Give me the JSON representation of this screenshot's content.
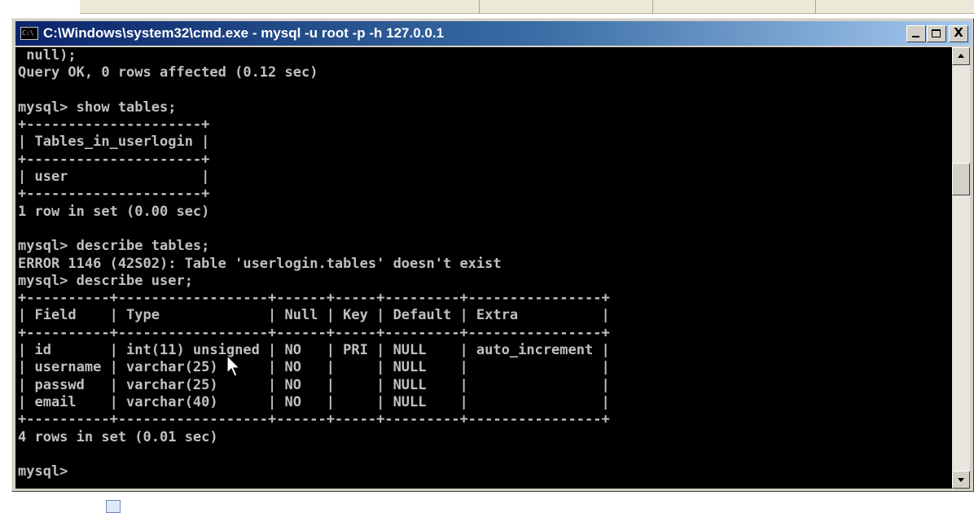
{
  "window": {
    "title": "C:\\Windows\\system32\\cmd.exe - mysql  -u root -p -h 127.0.0.1",
    "icon_name": "console-icon",
    "close_glyph": "X"
  },
  "console": {
    "lines": [
      " null);",
      "Query OK, 0 rows affected (0.12 sec)",
      "",
      "mysql> show tables;",
      "+---------------------+",
      "| Tables_in_userlogin |",
      "+---------------------+",
      "| user                |",
      "+---------------------+",
      "1 row in set (0.00 sec)",
      "",
      "mysql> describe tables;",
      "ERROR 1146 (42S02): Table 'userlogin.tables' doesn't exist",
      "mysql> describe user;",
      "+----------+------------------+------+-----+---------+----------------+",
      "| Field    | Type             | Null | Key | Default | Extra          |",
      "+----------+------------------+------+-----+---------+----------------+",
      "| id       | int(11) unsigned | NO   | PRI | NULL    | auto_increment |",
      "| username | varchar(25)      | NO   |     | NULL    |                |",
      "| passwd   | varchar(25)      | NO   |     | NULL    |                |",
      "| email    | varchar(40)      | NO   |     | NULL    |                |",
      "+----------+------------------+------+-----+---------+----------------+",
      "4 rows in set (0.01 sec)",
      "",
      "mysql>"
    ]
  },
  "colors": {
    "console_bg": "#000000",
    "console_text": "#c0c0c0",
    "title_gradient_start": "#0a246a",
    "title_gradient_end": "#a6caf0",
    "chrome": "#d4d0c8"
  }
}
